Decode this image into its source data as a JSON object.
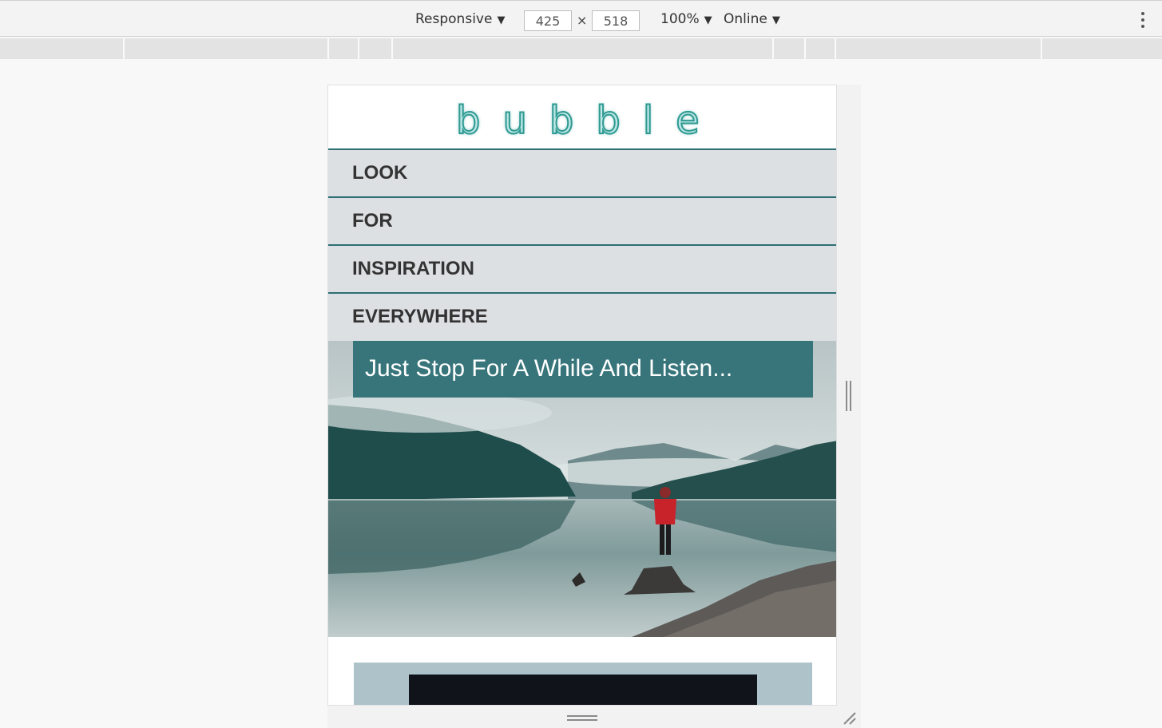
{
  "devtools": {
    "device_mode": "Responsive",
    "width": "425",
    "times": "×",
    "height": "518",
    "zoom": "100%",
    "network": "Online",
    "caret": "▼"
  },
  "site": {
    "logo": "bubble",
    "nav": [
      {
        "label": "LOOK"
      },
      {
        "label": "FOR"
      },
      {
        "label": "INSPIRATION"
      },
      {
        "label": "EVERYWHERE"
      }
    ],
    "hero_caption": "Just Stop For A While And Listen..."
  },
  "colors": {
    "nav_bg": "#dde0e3",
    "accent": "#2d6f75",
    "caption_bg": "#37757b",
    "section_bg": "#aec2ca"
  }
}
